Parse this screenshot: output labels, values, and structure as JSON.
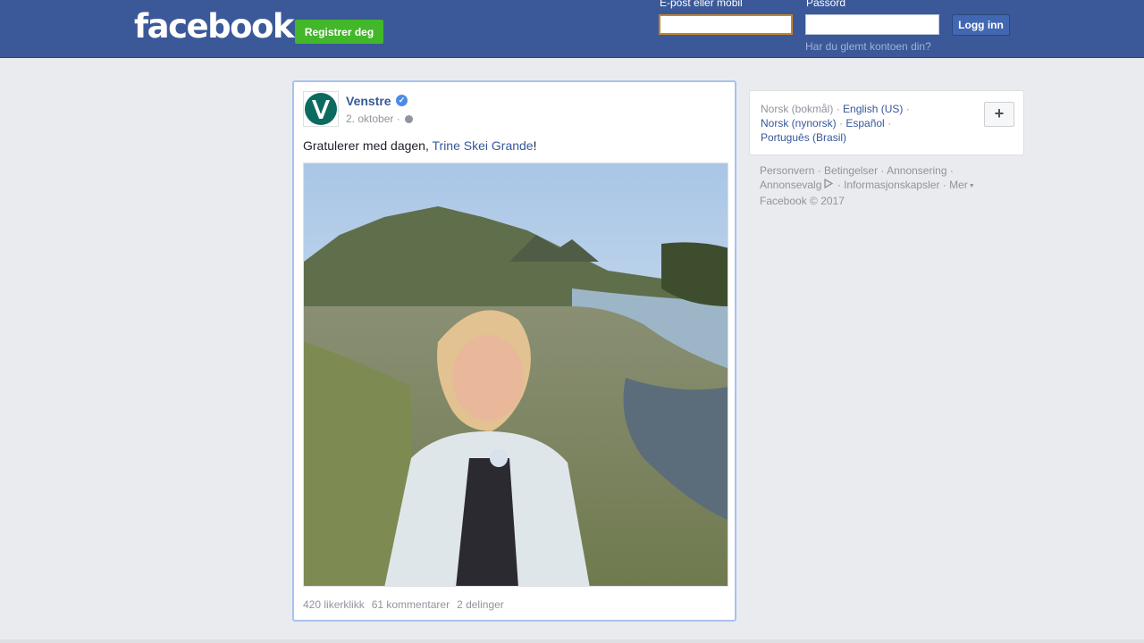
{
  "header": {
    "logo": "facebook",
    "register_label": "Registrer deg",
    "email_label": "E-post eller mobil",
    "email_value": "",
    "password_label": "Passord",
    "password_value": "",
    "login_label": "Logg inn",
    "forgot_label": "Har du glemt kontoen din?"
  },
  "post": {
    "page_name": "Venstre",
    "date": "2. oktober",
    "text_before": "Gratulerer med dagen, ",
    "mention": "Trine Skei Grande",
    "text_after": "!",
    "likes": "420 likerklikk",
    "comments": "61 kommentarer",
    "shares": "2 delinger"
  },
  "languages": {
    "current": "Norsk (bokmål)",
    "links": [
      "English (US)",
      "Norsk (nynorsk)",
      "Español",
      "Português (Brasil)"
    ]
  },
  "footer": {
    "links": [
      "Personvern",
      "Betingelser",
      "Annonsering",
      "Annonsevalg",
      "Informasjonskapsler",
      "Mer"
    ],
    "copyright": "Facebook © 2017"
  },
  "colors": {
    "brand_blue": "#3b5998",
    "register_green": "#42b72a",
    "link_blue": "#365899"
  },
  "icons": [
    "verified-badge-icon",
    "globe-icon",
    "plus-icon",
    "adchoices-icon",
    "dropdown-caret-icon"
  ]
}
